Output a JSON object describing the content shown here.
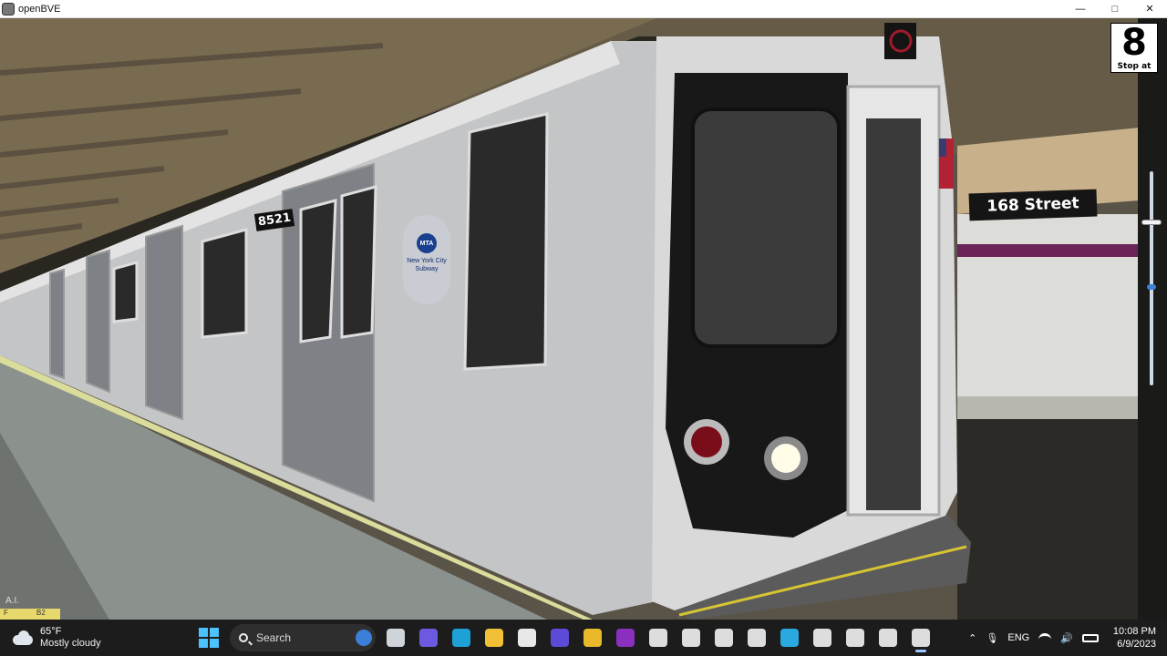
{
  "window": {
    "title": "openBVE",
    "controls": {
      "minimize": "—",
      "maximize": "□",
      "close": "✕"
    }
  },
  "hud": {
    "stop_number": "8",
    "stop_label": "Stop at",
    "station_sign": "168 Street",
    "car_number": "8521",
    "logo_badge": "MTA",
    "logo_text": "New York City Subway",
    "overlay_label": "A.I.",
    "overlay_bar_left": "F",
    "overlay_bar_right": "B2"
  },
  "taskbar": {
    "weather": {
      "temp": "65°F",
      "condition": "Mostly cloudy",
      "icon": "cloud-icon"
    },
    "search_label": "Search",
    "pinned": [
      {
        "name": "taskview-icon",
        "color": "#cfd3da"
      },
      {
        "name": "chat-icon",
        "color": "#6b5ae0"
      },
      {
        "name": "edge-icon",
        "color": "#1fa1d8"
      },
      {
        "name": "file-explorer-icon",
        "color": "#f2c037"
      },
      {
        "name": "store-icon",
        "color": "#e8e8e8"
      },
      {
        "name": "design-app-icon",
        "color": "#5b4bd6"
      },
      {
        "name": "chrome-icon",
        "color": "#e8ba2b"
      },
      {
        "name": "onenote-icon",
        "color": "#8b2fbf"
      },
      {
        "name": "openbve-icon-1",
        "color": "#dddddd"
      },
      {
        "name": "openbve-icon-2",
        "color": "#dddddd"
      },
      {
        "name": "openbve-icon-3",
        "color": "#dddddd"
      },
      {
        "name": "openbve-icon-4",
        "color": "#dddddd"
      },
      {
        "name": "kodi-icon",
        "color": "#2aa9e0"
      },
      {
        "name": "openbve-icon-5",
        "color": "#dddddd"
      },
      {
        "name": "recorder-icon",
        "color": "#dddddd"
      },
      {
        "name": "openbve-icon-6",
        "color": "#dddddd"
      },
      {
        "name": "openbve-icon-active",
        "color": "#dddddd"
      }
    ],
    "tray": {
      "chevron": "⌃",
      "mic": "🎙",
      "language": "ENG",
      "wifi": "wifi-icon",
      "volume": "🔊",
      "battery": "battery-icon"
    },
    "time": "10:08 PM",
    "date": "6/9/2023"
  }
}
